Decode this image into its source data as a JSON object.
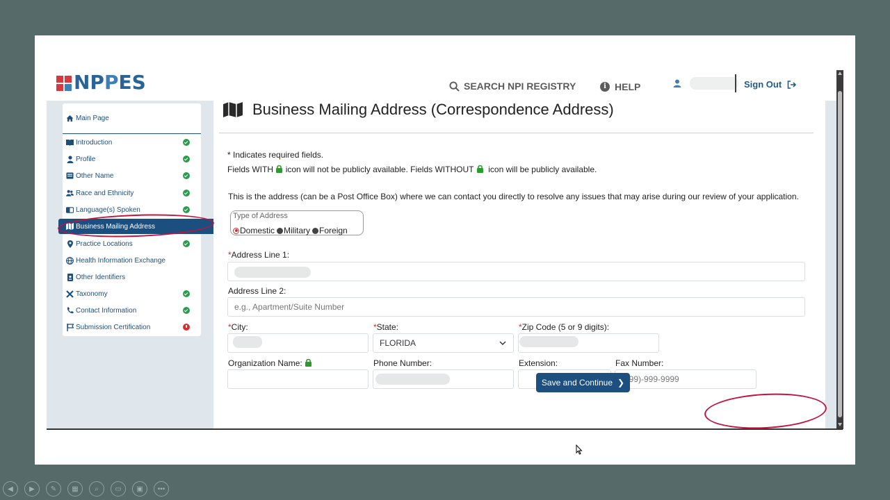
{
  "header": {
    "logo_text_1": "NP",
    "logo_text_2": "P",
    "logo_text_3": "ES",
    "search_label": "SEARCH NPI REGISTRY",
    "help_label": "HELP",
    "help_icon": "i",
    "signout_label": "Sign Out"
  },
  "sidebar": {
    "main_page": "Main Page",
    "items": [
      {
        "label": "Introduction",
        "status": "complete"
      },
      {
        "label": "Profile",
        "status": "complete"
      },
      {
        "label": "Other Name",
        "status": "complete"
      },
      {
        "label": "Race and Ethnicity",
        "status": "complete"
      },
      {
        "label": "Language(s) Spoken",
        "status": "complete"
      },
      {
        "label": "Business Mailing Address",
        "status": "active"
      },
      {
        "label": "Practice Locations",
        "status": "complete"
      },
      {
        "label": "Health Information Exchange",
        "status": "none"
      },
      {
        "label": "Other Identifiers",
        "status": "none"
      },
      {
        "label": "Taxonomy",
        "status": "complete"
      },
      {
        "label": "Contact Information",
        "status": "complete"
      },
      {
        "label": "Submission Certification",
        "status": "error"
      }
    ]
  },
  "main": {
    "title": "Business Mailing Address (Correspondence Address)",
    "required_note": "* Indicates required fields.",
    "lock_note_1": "Fields WITH",
    "lock_note_2": "icon will not be publicly available. Fields WITHOUT",
    "lock_note_3": "icon will be publicly available.",
    "description": "This is the address (can be a Post Office Box) where we can contact you directly to resolve any issues that may arise during our review of your application.",
    "address_type": {
      "legend": "Type of Address",
      "options": [
        "Domestic",
        "Military",
        "Foreign"
      ],
      "selected": "Domestic"
    },
    "fields": {
      "address1_label": "Address Line 1:",
      "address2_label": "Address Line 2:",
      "address2_placeholder": "e.g., Apartment/Suite Number",
      "city_label": "City:",
      "state_label": "State:",
      "state_value": "FLORIDA",
      "zip_label": "Zip Code (5 or 9 digits):",
      "org_label": "Organization Name:",
      "phone_label": "Phone Number:",
      "ext_label": "Extension:",
      "fax_label": "Fax Number:",
      "fax_placeholder": "(999)-999-9999",
      "required_mark": "*"
    },
    "save_label": "Save and Continue",
    "save_chevron": "❯"
  },
  "colors": {
    "brand_blue": "#1d4f80",
    "success_green": "#2c9a4f",
    "error_red": "#d32f2f",
    "annotation_red": "#c4123f"
  }
}
